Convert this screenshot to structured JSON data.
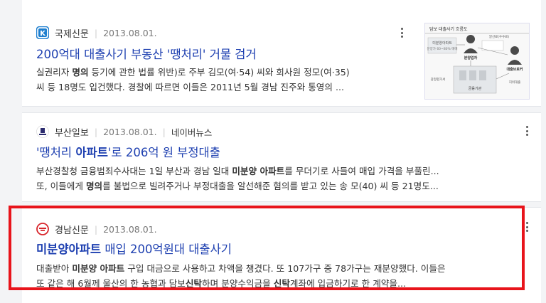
{
  "results": [
    {
      "source": "국제신문",
      "date": "2013.08.01.",
      "title_parts": [
        {
          "text": "200억대 대출사기 부동산 '땡처리' 거물 검거",
          "bold": false
        }
      ],
      "snippet": [
        [
          {
            "text": "실권리자 ",
            "bold": false
          },
          {
            "text": "명의",
            "bold": true
          },
          {
            "text": " 등기에 관한 법률 위반)로 주부 김모(여·54) 씨와 회사원 정모(여·35)",
            "bold": false
          }
        ],
        [
          {
            "text": "씨 등 18명도 입건했다. 경찰에 따르면 이들은 2011년 5월 경남 진주와 통영의 ...",
            "bold": false
          }
        ]
      ],
      "thumbnail": {
        "header": "담보 대출사기 흐름도",
        "labels": [
          "미분양아파트",
          "분양가 60~80% 매매",
          "분양업자",
          "대출브로커",
          "알선료(수수료)",
          "금융기관",
          "감정평가서",
          "허위대출"
        ]
      },
      "logo_color": "#1e7fcf"
    },
    {
      "source": "부산일보",
      "date": "2013.08.01.",
      "extra": "네이버뉴스",
      "title_parts": [
        {
          "text": "'땡처리 ",
          "bold": false
        },
        {
          "text": "아파트",
          "bold": true
        },
        {
          "text": "'로 206억 원 부정대출",
          "bold": false
        }
      ],
      "snippet": [
        [
          {
            "text": "부산경찰청 금융범죄수사대는 1일 부산과 경남 일대 ",
            "bold": false
          },
          {
            "text": "미분양 아파트",
            "bold": true
          },
          {
            "text": "를 무더기로 사들여 매입 가격을 부풀린...",
            "bold": false
          }
        ],
        [
          {
            "text": "또, 이들에게 ",
            "bold": false
          },
          {
            "text": "명의",
            "bold": true
          },
          {
            "text": "를 불법으로 빌려주거나 부정대출을 알선해준 혐의를 받고 있는 송 모(40) 씨 등 21명도...",
            "bold": false
          }
        ]
      ],
      "logo_color": "#2b2b6e"
    },
    {
      "source": "경남신문",
      "date": "2013.08.01.",
      "title_parts": [
        {
          "text": "미분양아파트",
          "bold": true
        },
        {
          "text": " 매입 200억원대 대출사기",
          "bold": false
        }
      ],
      "snippet": [
        [
          {
            "text": "대출받아 ",
            "bold": false
          },
          {
            "text": "미분양 아파트",
            "bold": true
          },
          {
            "text": " 구입 대금으로 사용하고 차액을 챙겼다. 또 107가구 중 78가구는 재분양했다. 이들은",
            "bold": false
          }
        ],
        [
          {
            "text": "또 같은 해 6월께 울산의 한 농협과 담보",
            "bold": false
          },
          {
            "text": "신탁",
            "bold": true
          },
          {
            "text": "하며 분양수익금을 ",
            "bold": false
          },
          {
            "text": "신탁",
            "bold": true
          },
          {
            "text": "계좌에 입금하기로 한 계약을...",
            "bold": false
          }
        ]
      ],
      "logo_color": "#d8262c"
    }
  ],
  "highlight_color": "#e8141b",
  "icons": {
    "more": "more-vertical-icon"
  }
}
